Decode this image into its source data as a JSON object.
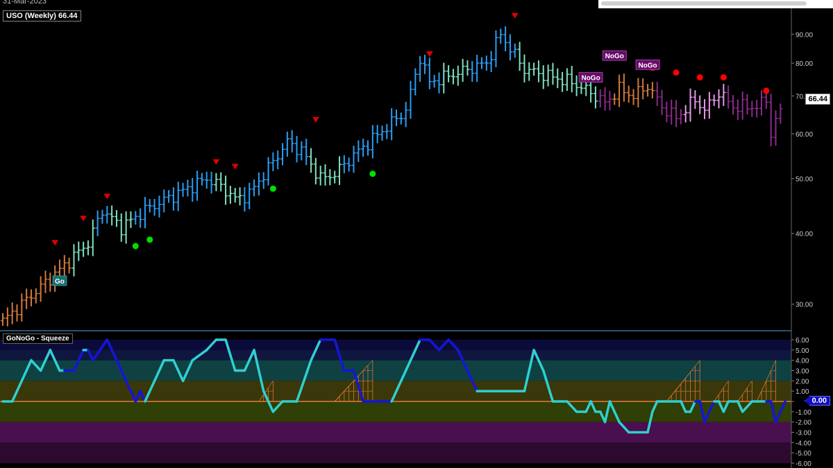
{
  "header": {
    "date": "31-Mar-2023",
    "title": "USO (Weekly) 66.44",
    "oscillator_title": "GoNoGo - Squeeze"
  },
  "badges": {
    "last_price": "66.44",
    "oscillator_value": "0.00"
  },
  "colors": {
    "background": "#000000",
    "go_strong": "#2a9df4",
    "go_weak": "#7fe0c0",
    "nogo_strong": "#8b2a8b",
    "nogo_weak": "#e39be3",
    "amber": "#d2793b",
    "osc_line": "#2fd0d0",
    "osc_line_strong": "#1515d8",
    "zero_line": "#e87b3b",
    "squeeze": "#e0762a",
    "marker_down": "#e00000",
    "marker_go": "#00e000",
    "marker_nogo": "#ff0000",
    "go_label_bg": "#1a6e70",
    "nogo_label_bg": "#6a0a6a"
  },
  "chart_data": [
    {
      "type": "ohlc",
      "name": "price",
      "scale": "log",
      "ylim": [
        27,
        100
      ],
      "yticks": [
        "90.00",
        "80.00",
        "70.00",
        "60.00",
        "50.00",
        "40.00",
        "30.00"
      ],
      "ytick_values": [
        90,
        80,
        70,
        60,
        50,
        40,
        30
      ],
      "anchors": [
        [
          0,
          28.0,
          "amber"
        ],
        [
          12,
          34.5,
          "amber"
        ],
        [
          18,
          38.5,
          "go_weak"
        ],
        [
          21,
          44,
          "go_strong"
        ],
        [
          25,
          41,
          "go_weak"
        ],
        [
          30,
          44,
          "go_strong"
        ],
        [
          43,
          50,
          "go_strong"
        ],
        [
          46,
          48.5,
          "go_weak"
        ],
        [
          49,
          46,
          "go_weak"
        ],
        [
          52,
          47,
          "go_strong"
        ],
        [
          60,
          58,
          "go_strong"
        ],
        [
          63,
          56,
          "go_strong"
        ],
        [
          67,
          50,
          "go_weak"
        ],
        [
          70,
          51,
          "go_weak"
        ],
        [
          74,
          55,
          "go_strong"
        ],
        [
          85,
          66,
          "go_strong"
        ],
        [
          88,
          82,
          "go_strong"
        ],
        [
          90,
          74,
          "go_strong"
        ],
        [
          96,
          77,
          "go_weak"
        ],
        [
          102,
          80,
          "go_strong"
        ],
        [
          105,
          90,
          "go_strong"
        ],
        [
          107,
          85,
          "go_strong"
        ],
        [
          110,
          78,
          "go_weak"
        ],
        [
          120,
          74,
          "go_weak"
        ],
        [
          124,
          71,
          "go_weak"
        ],
        [
          127,
          68,
          "nogo_strong"
        ],
        [
          130,
          72,
          "amber"
        ],
        [
          133,
          70,
          "amber"
        ],
        [
          136,
          73,
          "amber"
        ],
        [
          139,
          67,
          "nogo_strong"
        ],
        [
          142,
          64,
          "nogo_strong"
        ],
        [
          146,
          69,
          "nogo_weak"
        ],
        [
          148,
          66,
          "nogo_weak"
        ],
        [
          151,
          71,
          "nogo_weak"
        ],
        [
          154,
          67,
          "nogo_strong"
        ],
        [
          159,
          67,
          "nogo_strong"
        ],
        [
          161,
          69,
          "nogo_strong"
        ],
        [
          162,
          60,
          "nogo_strong"
        ],
        [
          164,
          66.44,
          "nogo_strong"
        ]
      ],
      "labels": [
        {
          "text": "Go",
          "index": 12,
          "price": 33.0,
          "kind": "go"
        },
        {
          "text": "NoGo",
          "index": 129,
          "price": 82.5,
          "kind": "nogo"
        },
        {
          "text": "NoGo",
          "index": 124,
          "price": 75.5,
          "kind": "nogo"
        },
        {
          "text": "NoGo",
          "index": 136,
          "price": 79.5,
          "kind": "nogo"
        }
      ],
      "down_markers": [
        [
          11,
          38.5
        ],
        [
          17,
          42.5
        ],
        [
          22,
          46.5
        ],
        [
          45,
          53.5
        ],
        [
          49,
          52.5
        ],
        [
          66,
          63.5
        ],
        [
          90,
          83
        ],
        [
          108,
          97
        ]
      ],
      "go_dots": [
        [
          28,
          38.0
        ],
        [
          31,
          39.0
        ],
        [
          57,
          48.0
        ],
        [
          78,
          51.0
        ]
      ],
      "nogo_dots": [
        [
          137,
          78.5
        ],
        [
          142,
          77.0
        ],
        [
          147,
          75.5
        ],
        [
          152,
          75.5
        ],
        [
          161,
          71.5
        ]
      ]
    },
    {
      "type": "line",
      "name": "oscillator",
      "ylim": [
        -6,
        6
      ],
      "yticks": [
        "6.00",
        "5.00",
        "4.00",
        "3.00",
        "2.00",
        "1.00",
        "0.00",
        "-1.00",
        "-2.00",
        "-3.00",
        "-4.00",
        "-5.00",
        "-6.00"
      ],
      "ytick_values": [
        6,
        5,
        4,
        3,
        2,
        1,
        0,
        -1,
        -2,
        -3,
        -4,
        -5,
        -6
      ],
      "bands": [
        {
          "from": 5,
          "to": 6,
          "color": "#0b0b3b"
        },
        {
          "from": 4,
          "to": 5,
          "color": "#10173f"
        },
        {
          "from": 2,
          "to": 4,
          "color": "#0f4143"
        },
        {
          "from": 0,
          "to": 2,
          "color": "#3a380a"
        },
        {
          "from": -2,
          "to": 0,
          "color": "#2f3f05"
        },
        {
          "from": -4,
          "to": -2,
          "color": "#4a0f4f"
        },
        {
          "from": -6,
          "to": -4,
          "color": "#2c0a30"
        }
      ],
      "points": [
        [
          0,
          0,
          "w"
        ],
        [
          2,
          0,
          "w"
        ],
        [
          6,
          4,
          "w"
        ],
        [
          8,
          3,
          "w"
        ],
        [
          10,
          5,
          "w"
        ],
        [
          12,
          3,
          "w"
        ],
        [
          13,
          3,
          "w"
        ],
        [
          15,
          3,
          "s"
        ],
        [
          17,
          5,
          "s"
        ],
        [
          18,
          5,
          "w"
        ],
        [
          19,
          4,
          "s"
        ],
        [
          22,
          6,
          "s"
        ],
        [
          25,
          3,
          "s"
        ],
        [
          28,
          0,
          "s"
        ],
        [
          29,
          1,
          "s"
        ],
        [
          30,
          0,
          "s"
        ],
        [
          32,
          2,
          "w"
        ],
        [
          34,
          4,
          "w"
        ],
        [
          36,
          4,
          "w"
        ],
        [
          38,
          2,
          "w"
        ],
        [
          40,
          4,
          "w"
        ],
        [
          43,
          5,
          "w"
        ],
        [
          45,
          6,
          "w"
        ],
        [
          47,
          6,
          "w"
        ],
        [
          49,
          3,
          "w"
        ],
        [
          51,
          3,
          "w"
        ],
        [
          53,
          5,
          "w"
        ],
        [
          55,
          1,
          "w"
        ],
        [
          57,
          -1,
          "w"
        ],
        [
          59,
          0,
          "w"
        ],
        [
          62,
          0,
          "w"
        ],
        [
          65,
          4,
          "w"
        ],
        [
          67,
          6,
          "w"
        ],
        [
          70,
          6,
          "s"
        ],
        [
          72,
          3,
          "s"
        ],
        [
          74,
          3,
          "s"
        ],
        [
          76,
          0,
          "s"
        ],
        [
          82,
          0,
          "s"
        ],
        [
          84,
          2,
          "w"
        ],
        [
          86,
          4,
          "w"
        ],
        [
          88,
          6,
          "w"
        ],
        [
          90,
          6,
          "s"
        ],
        [
          92,
          5,
          "s"
        ],
        [
          94,
          6,
          "s"
        ],
        [
          96,
          5,
          "s"
        ],
        [
          98,
          3,
          "s"
        ],
        [
          100,
          1,
          "s"
        ],
        [
          102,
          1,
          "w"
        ],
        [
          110,
          1,
          "w"
        ],
        [
          112,
          5,
          "w"
        ],
        [
          114,
          3,
          "w"
        ],
        [
          116,
          0,
          "w"
        ],
        [
          119,
          0,
          "w"
        ],
        [
          121,
          -1,
          "w"
        ],
        [
          123,
          -1,
          "w"
        ],
        [
          124,
          0,
          "w"
        ],
        [
          125,
          -1,
          "w"
        ],
        [
          126,
          -1,
          "w"
        ],
        [
          127,
          -2,
          "w"
        ],
        [
          128,
          0,
          "w"
        ],
        [
          129,
          -1,
          "w"
        ],
        [
          130,
          -2,
          "w"
        ],
        [
          132,
          -3,
          "w"
        ],
        [
          136,
          -3,
          "w"
        ],
        [
          137,
          -1,
          "w"
        ],
        [
          138,
          0,
          "w"
        ],
        [
          143,
          0,
          "w"
        ],
        [
          144,
          -1,
          "w"
        ],
        [
          145,
          -1,
          "w"
        ],
        [
          146,
          0,
          "w"
        ],
        [
          147,
          0,
          "s"
        ],
        [
          148,
          -2,
          "s"
        ],
        [
          150,
          0,
          "s"
        ],
        [
          151,
          0,
          "w"
        ],
        [
          152,
          -1,
          "w"
        ],
        [
          153,
          0,
          "w"
        ],
        [
          155,
          0,
          "w"
        ],
        [
          156,
          -1,
          "w"
        ],
        [
          158,
          0,
          "w"
        ],
        [
          161,
          0,
          "w"
        ],
        [
          162,
          0,
          "s"
        ],
        [
          163,
          -2,
          "s"
        ],
        [
          165,
          0,
          "s"
        ]
      ],
      "squeeze": [
        {
          "from": 54,
          "to": 57,
          "peak": 2
        },
        {
          "from": 70,
          "to": 78,
          "peak": 4
        },
        {
          "from": 140,
          "to": 147,
          "peak": 4
        },
        {
          "from": 150,
          "to": 153,
          "peak": 2
        },
        {
          "from": 155,
          "to": 158,
          "peak": 2
        },
        {
          "from": 159,
          "to": 163,
          "peak": 4
        }
      ]
    }
  ]
}
